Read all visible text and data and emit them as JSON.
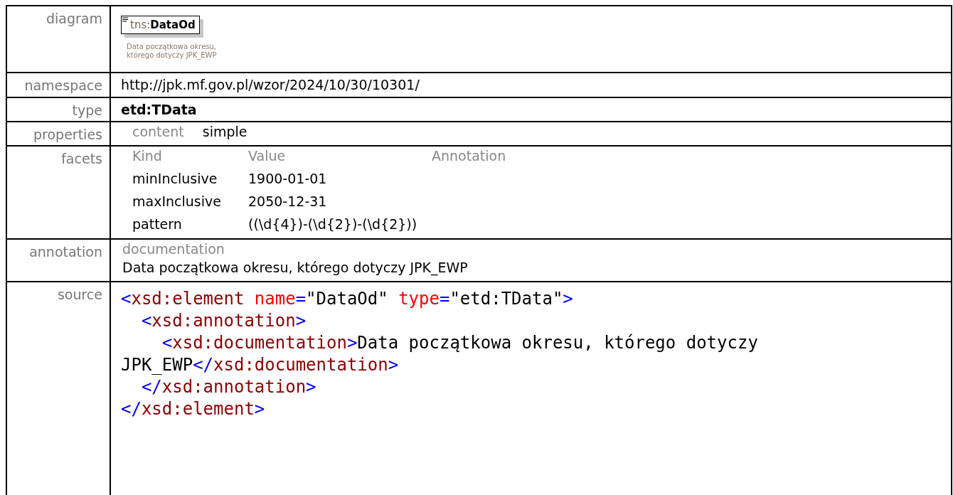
{
  "rows": [
    {
      "label": "diagram",
      "kind": "diagram",
      "prefix": "tns:",
      "name": "DataOd",
      "note_lines": [
        "Data początkowa okresu,",
        "którego dotyczy JPK_EWP"
      ]
    },
    {
      "label": "namespace",
      "kind": "text",
      "value": "http://jpk.mf.gov.pl/wzor/2024/10/30/10301/"
    },
    {
      "label": "type",
      "kind": "bold",
      "value": "etd:TData"
    },
    {
      "label": "properties",
      "kind": "props",
      "items": [
        {
          "key": "content",
          "value": "simple"
        }
      ]
    },
    {
      "label": "facets",
      "kind": "facets",
      "columns": [
        "Kind",
        "Value",
        "Annotation"
      ],
      "rows": [
        [
          "minInclusive",
          "1900-01-01"
        ],
        [
          "maxInclusive",
          "2050-12-31"
        ],
        [
          "pattern",
          "((\\d{4})-(\\d{2})-(\\d{2}))"
        ]
      ]
    },
    {
      "label": "annotation",
      "kind": "annotation",
      "heading": "documentation",
      "value": "Data początkowa okresu, którego dotyczy JPK_EWP"
    },
    {
      "label": "source",
      "kind": "source",
      "lines": [
        [
          {
            "kind": "bracket",
            "text": "<"
          },
          {
            "kind": "tag",
            "text": "xsd:element"
          },
          {
            "kind": "attr",
            "text": " name"
          },
          {
            "kind": "bracket",
            "text": "="
          },
          {
            "kind": "text",
            "text": "\"DataOd\""
          },
          {
            "kind": "attr",
            "text": " type"
          },
          {
            "kind": "bracket",
            "text": "="
          },
          {
            "kind": "text",
            "text": "\"etd:TData\""
          },
          {
            "kind": "bracket",
            "text": ">"
          }
        ],
        [
          {
            "kind": "bracket",
            "text": "  <"
          },
          {
            "kind": "tag",
            "text": "xsd:annotation"
          },
          {
            "kind": "bracket",
            "text": ">"
          }
        ],
        [
          {
            "kind": "bracket",
            "text": "    <"
          },
          {
            "kind": "tag",
            "text": "xsd:documentation"
          },
          {
            "kind": "bracket",
            "text": ">"
          },
          {
            "kind": "text",
            "text": "Data początkowa okresu, którego dotyczy"
          }
        ],
        [
          {
            "kind": "text",
            "text": "JPK_EWP"
          },
          {
            "kind": "bracket",
            "text": "</"
          },
          {
            "kind": "tag",
            "text": "xsd:documentation"
          },
          {
            "kind": "bracket",
            "text": ">"
          }
        ],
        [
          {
            "kind": "bracket",
            "text": "  </"
          },
          {
            "kind": "tag",
            "text": "xsd:annotation"
          },
          {
            "kind": "bracket",
            "text": ">"
          }
        ],
        [
          {
            "kind": "bracket",
            "text": "</"
          },
          {
            "kind": "tag",
            "text": "xsd:element"
          },
          {
            "kind": "bracket",
            "text": ">"
          }
        ]
      ]
    }
  ]
}
